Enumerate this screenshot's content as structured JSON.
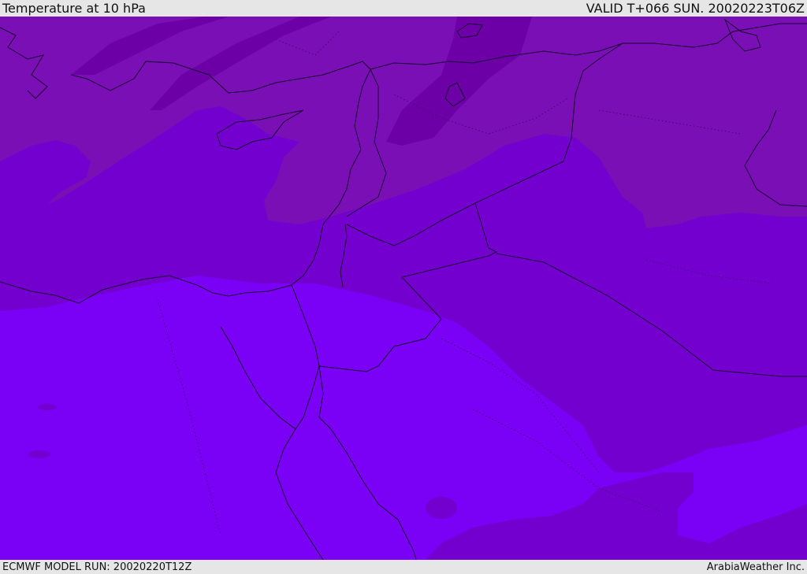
{
  "header": {
    "title": "Temperature at 10 hPa",
    "valid": "VALID T+066 SUN. 20020223T06Z"
  },
  "footer": {
    "model_run": "ECMWF MODEL RUN: 20020220T12Z",
    "brand": "ArabiaWeather Inc."
  },
  "colors": {
    "band_darkest": "#6c00a6",
    "band_dark": "#7a0fb5",
    "band_mid": "#7400d0",
    "band_light": "#7a00f6",
    "coast": "#1a0030",
    "frame_bg": "#e6e6e6"
  }
}
